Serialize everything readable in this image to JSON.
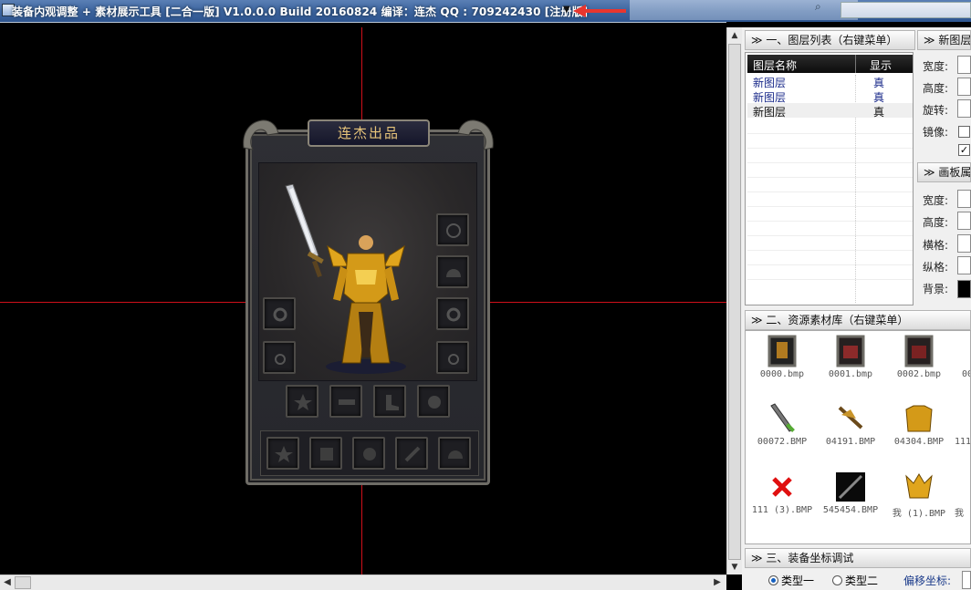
{
  "window": {
    "title": "装备内观调整 + 素材展示工具 [二合一版] V1.0.0.0 Build 20160824  编译：连杰 QQ : 709242430 [注册版]",
    "menu_caret": "▼"
  },
  "equipment_panel": {
    "header": "连杰出品"
  },
  "layer_panel": {
    "header": "≫ 一、图层列表（右键菜单）",
    "columns": [
      "图层名称",
      "显示"
    ],
    "rows": [
      {
        "name": "新图层",
        "visible": "真"
      },
      {
        "name": "新图层",
        "visible": "真"
      },
      {
        "name": "新图层",
        "visible": "真"
      }
    ]
  },
  "new_layer_props": {
    "header": "≫ 新图层",
    "labels": [
      "宽度:",
      "高度:",
      "旋转:",
      "镜像:"
    ],
    "mirror_checked": false,
    "extra_checked": true
  },
  "canvas_props": {
    "header": "≫ 画板属",
    "labels": [
      "宽度:",
      "高度:",
      "横格:",
      "纵格:",
      "背景:"
    ],
    "background_color": "#000000"
  },
  "asset_panel": {
    "header": "≫ 二、资源素材库（右键菜单）",
    "items": [
      {
        "file": "0000.bmp",
        "icon": "frame-icon"
      },
      {
        "file": "0001.bmp",
        "icon": "frame-icon"
      },
      {
        "file": "0002.bmp",
        "icon": "frame-icon"
      },
      {
        "file": "00072.BMP",
        "icon": "sword-icon"
      },
      {
        "file": "04191.BMP",
        "icon": "weapon-icon"
      },
      {
        "file": "04304.BMP",
        "icon": "armor-icon"
      },
      {
        "file": "111 (3).BMP",
        "icon": "red-x-icon"
      },
      {
        "file": "545454.BMP",
        "icon": "blade-icon"
      },
      {
        "file": "我 (1).BMP",
        "icon": "helmet-icon"
      }
    ],
    "partial_captions": [
      "00",
      "111",
      "我"
    ]
  },
  "coord_panel": {
    "header": "≫ 三、装备坐标调试",
    "radio_type1": "类型一",
    "radio_type2": "类型二",
    "offset_label": "偏移坐标:",
    "selected": "类型一"
  },
  "colors": {
    "crosshair": "#d0101a",
    "titlebar": "#3d659f",
    "header_gold": "#e7c47a"
  }
}
